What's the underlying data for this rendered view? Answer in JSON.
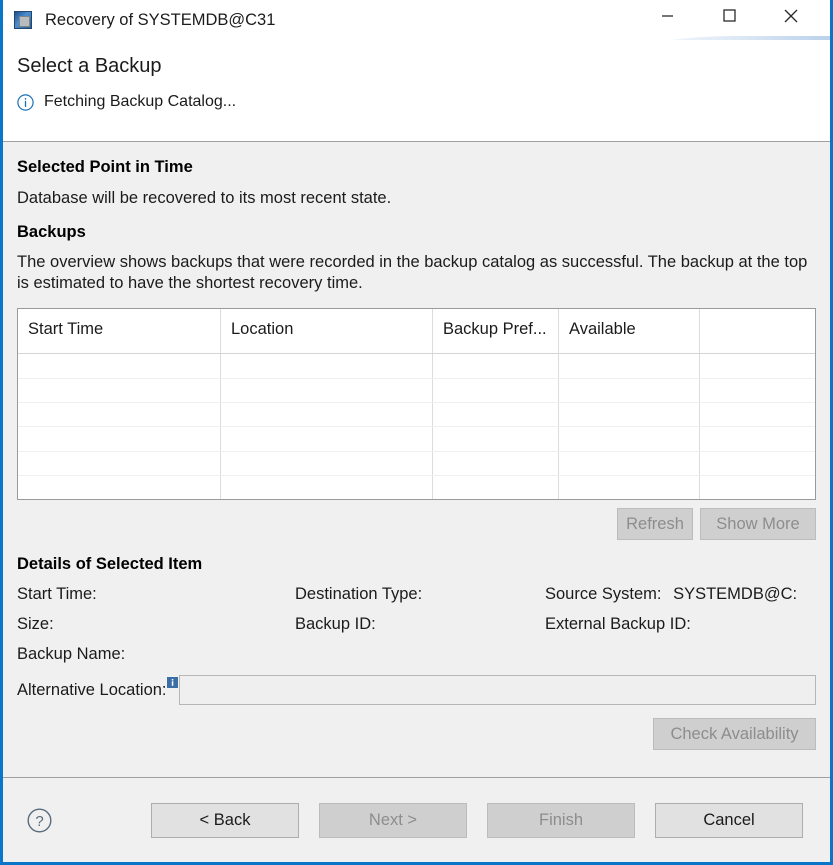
{
  "window": {
    "title": "Recovery of SYSTEMDB@C31",
    "app_icon": "database-window-icon",
    "accent_border": "#0a76c8",
    "controls": {
      "minimize": "minimize-icon",
      "maximize": "maximize-icon",
      "close": "close-icon"
    }
  },
  "header": {
    "page_title": "Select a Backup",
    "status_icon": "info-icon",
    "status_text": "Fetching Backup Catalog..."
  },
  "point_in_time": {
    "heading": "Selected Point in Time",
    "description": "Database will be recovered to its most recent state."
  },
  "backups": {
    "heading": "Backups",
    "description": "The overview shows backups that were recorded in the backup catalog as successful. The backup at the top is estimated to have the shortest recovery time.",
    "table": {
      "columns": [
        "Start Time",
        "Location",
        "Backup Pref...",
        "Available",
        ""
      ],
      "rows": [],
      "empty_row_count": 6
    },
    "refresh_label": "Refresh",
    "show_more_label": "Show More"
  },
  "details": {
    "heading": "Details of Selected Item",
    "fields": [
      {
        "label": "Start Time:",
        "value": ""
      },
      {
        "label": "Destination Type:",
        "value": ""
      },
      {
        "label": "Source System:",
        "value": "SYSTEMDB@C:"
      },
      {
        "label": "Size:",
        "value": ""
      },
      {
        "label": "Backup ID:",
        "value": ""
      },
      {
        "label": "External Backup ID:",
        "value": ""
      },
      {
        "label": "Backup Name:",
        "value": ""
      }
    ],
    "alternative_location": {
      "label": "Alternative Location:",
      "info_icon": "info-badge-icon",
      "value": "",
      "placeholder": ""
    },
    "check_availability_label": "Check Availability"
  },
  "footer": {
    "help_icon": "help-icon",
    "buttons": [
      {
        "label": "< Back",
        "enabled": true
      },
      {
        "label": "Next >",
        "enabled": false
      },
      {
        "label": "Finish",
        "enabled": false
      },
      {
        "label": "Cancel",
        "enabled": true
      }
    ]
  }
}
